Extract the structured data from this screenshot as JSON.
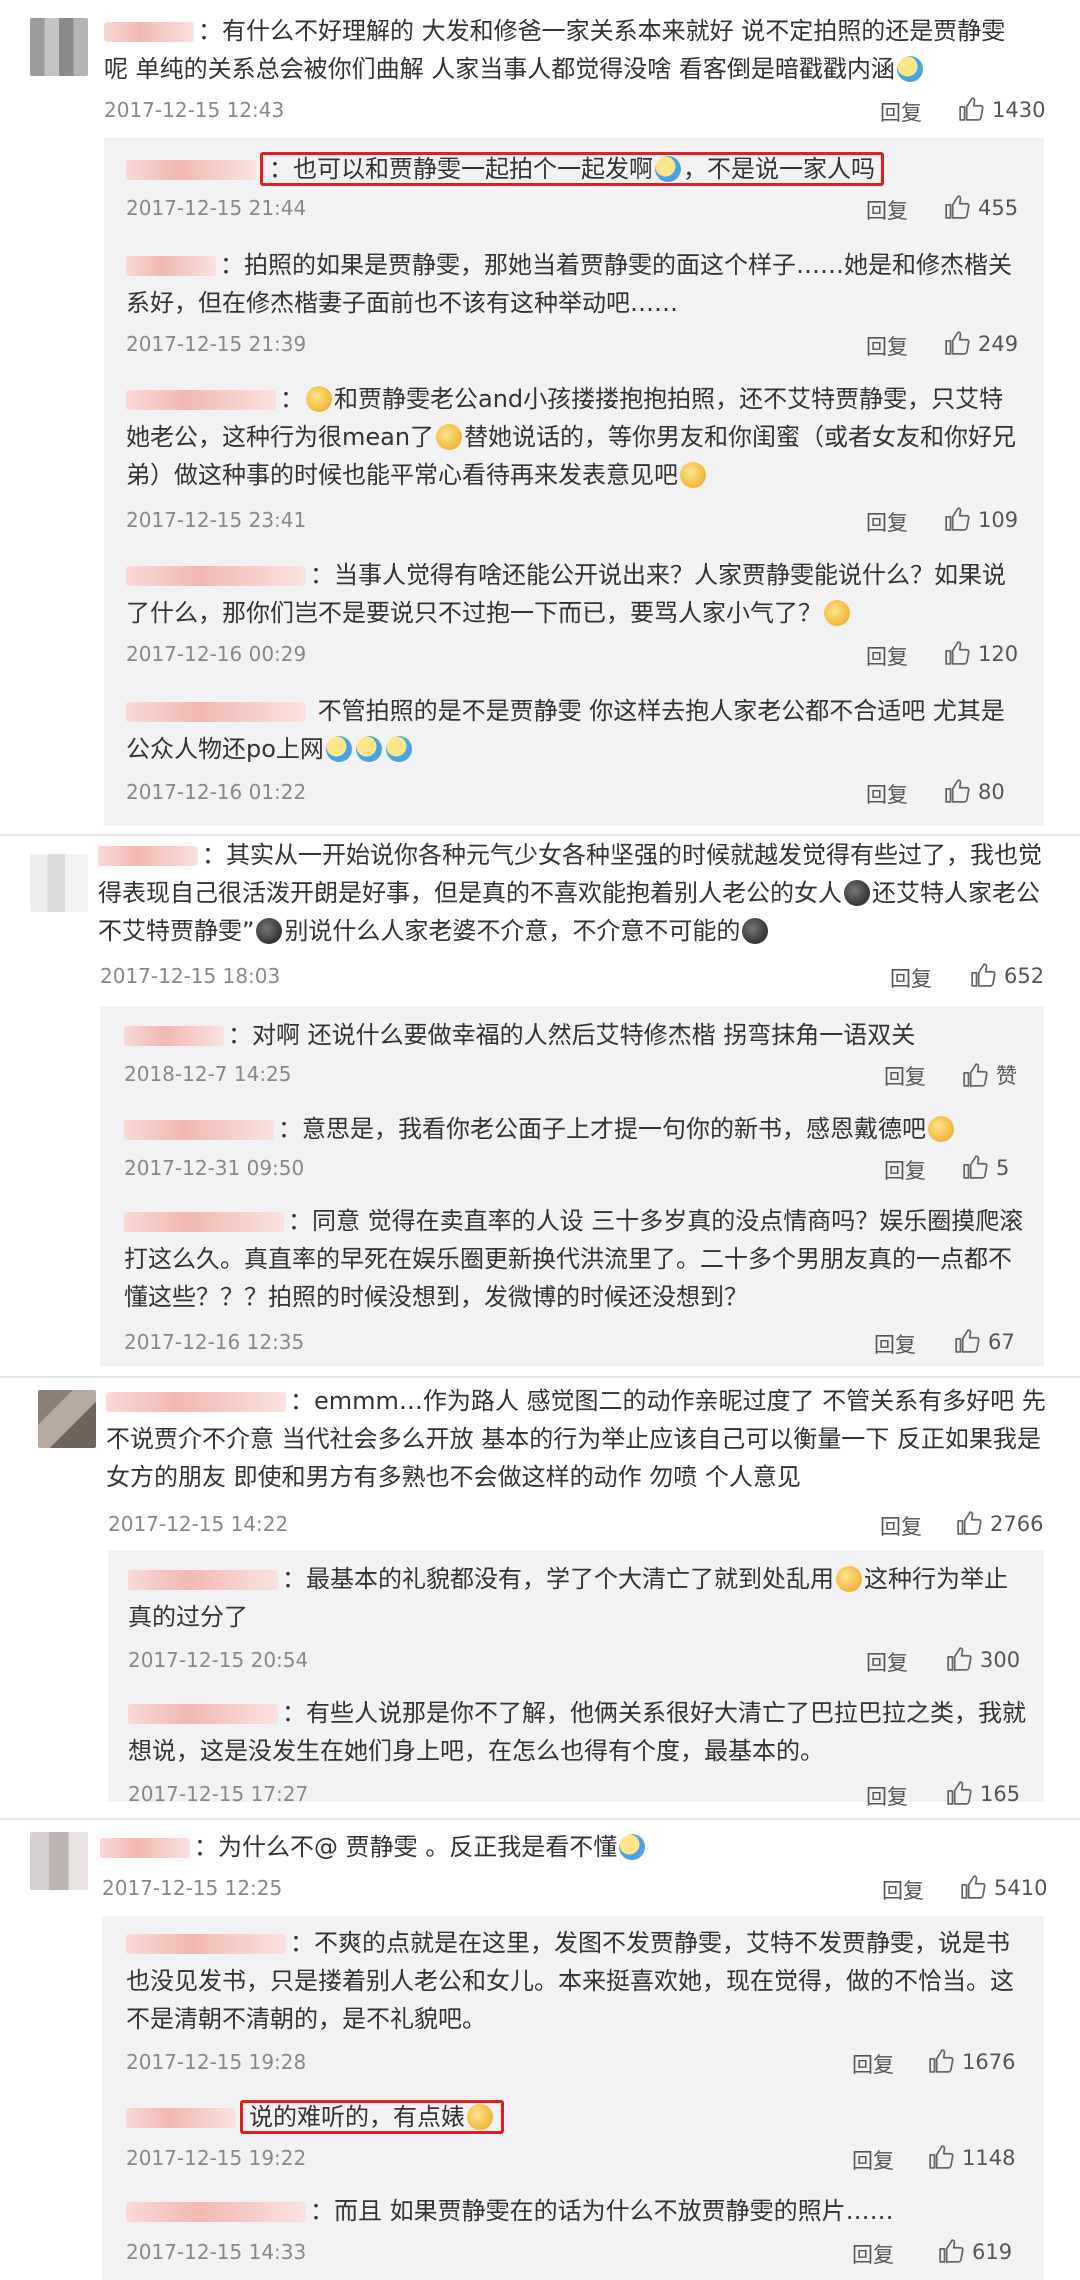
{
  "threads": [
    {
      "text": "有什么不好理解的 大发和修爸一家关系本来就好 说不定拍照的还是贾静雯呢 单纯的关系总会被你们曲解 人家当事人都觉得没啥 看客倒是暗戳戳内涵",
      "time": "2017-12-15 12:43",
      "reply": "回复",
      "likes": "1430",
      "replies": [
        {
          "text": "也可以和贾静雯一起拍个一起发啊",
          "text2": "，不是说一家人吗",
          "time": "2017-12-15 21:44",
          "reply": "回复",
          "likes": "455"
        },
        {
          "text": "拍照的如果是贾静雯，那她当着贾静雯的面这个样子……她是和修杰楷关系好，但在修杰楷妻子面前也不该有这种举动吧……",
          "time": "2017-12-15 21:39",
          "reply": "回复",
          "likes": "249"
        },
        {
          "text": "和贾静雯老公and小孩搂搂抱抱拍照，还不艾特贾静雯，只艾特她老公，这种行为很mean了",
          "text2": "替她说话的，等你男友和你闺蜜（或者女友和你好兄弟）做这种事的时候也能平常心看待再来发表意见吧",
          "time": "2017-12-15 23:41",
          "reply": "回复",
          "likes": "109"
        },
        {
          "text": "当事人觉得有啥还能公开说出来？人家贾静雯能说什么？如果说了什么，那你们岂不是要说只不过抱一下而已，要骂人家小气了？",
          "time": "2017-12-16 00:29",
          "reply": "回复",
          "likes": "120"
        },
        {
          "text": "不管拍照的是不是贾静雯 你这样去抱人家老公都不合适吧 尤其是公众人物还po上网",
          "time": "2017-12-16 01:22",
          "reply": "回复",
          "likes": "80"
        }
      ]
    },
    {
      "text": "其实从一开始说你各种元气少女各种坚强的时候就越发觉得有些过了，我也觉得表现自己很活泼开朗是好事，但是真的不喜欢能抱着别人老公的女人",
      "text2": "还艾特人家老公不艾特贾静雯”",
      "text3": "别说什么人家老婆不介意，不介意不可能的",
      "time": "2017-12-15 18:03",
      "reply": "回复",
      "likes": "652",
      "replies": [
        {
          "text": "对啊 还说什么要做幸福的人然后艾特修杰楷 拐弯抹角一语双关",
          "time": "2018-12-7 14:25",
          "reply": "回复",
          "likes": "赞"
        },
        {
          "text": "意思是，我看你老公面子上才提一句你的新书，感恩戴德吧",
          "time": "2017-12-31 09:50",
          "reply": "回复",
          "likes": "5"
        },
        {
          "text": "同意 觉得在卖直率的人设 三十多岁真的没点情商吗？娱乐圈摸爬滚打这么久。真直率的早死在娱乐圈更新换代洪流里了。二十多个男朋友真的一点都不懂这些？？？拍照的时候没想到，发微博的时候还没想到？",
          "time": "2017-12-16 12:35",
          "reply": "回复",
          "likes": "67"
        }
      ]
    },
    {
      "text": "emmm…作为路人 感觉图二的动作亲昵过度了 不管关系有多好吧 先不说贾介不介意 当代社会多么开放 基本的行为举止应该自己可以衡量一下 反正如果我是女方的朋友 即使和男方有多熟也不会做这样的动作 勿喷 个人意见",
      "time": "2017-12-15 14:22",
      "reply": "回复",
      "likes": "2766",
      "replies": [
        {
          "text": "最基本的礼貌都没有，学了个大清亡了就到处乱用",
          "text2": "这种行为举止真的过分了",
          "time": "2017-12-15 20:54",
          "reply": "回复",
          "likes": "300"
        },
        {
          "text": "有些人说那是你不了解，他俩关系很好大清亡了巴拉巴拉之类，我就想说，这是没发生在她们身上吧，在怎么也得有个度，最基本的。",
          "time": "2017-12-15 17:27",
          "reply": "回复",
          "likes": "165"
        }
      ]
    },
    {
      "text": "为什么不@ 贾静雯 。反正我是看不懂",
      "time": "2017-12-15 12:25",
      "reply": "回复",
      "likes": "5410",
      "replies": [
        {
          "text": "不爽的点就是在这里，发图不发贾静雯，艾特不发贾静雯，说是书也没见发书，只是搂着别人老公和女儿。本来挺喜欢她，现在觉得，做的不恰当。这不是清朝不清朝的，是不礼貌吧。",
          "time": "2017-12-15 19:28",
          "reply": "回复",
          "likes": "1676"
        },
        {
          "text": "说的难听的，有点婊",
          "time": "2017-12-15 19:22",
          "reply": "回复",
          "likes": "1148"
        },
        {
          "text": "而且 如果贾静雯在的话为什么不放贾静雯的照片……",
          "time": "2017-12-15 14:33",
          "reply": "回复",
          "likes": "619"
        }
      ]
    }
  ]
}
